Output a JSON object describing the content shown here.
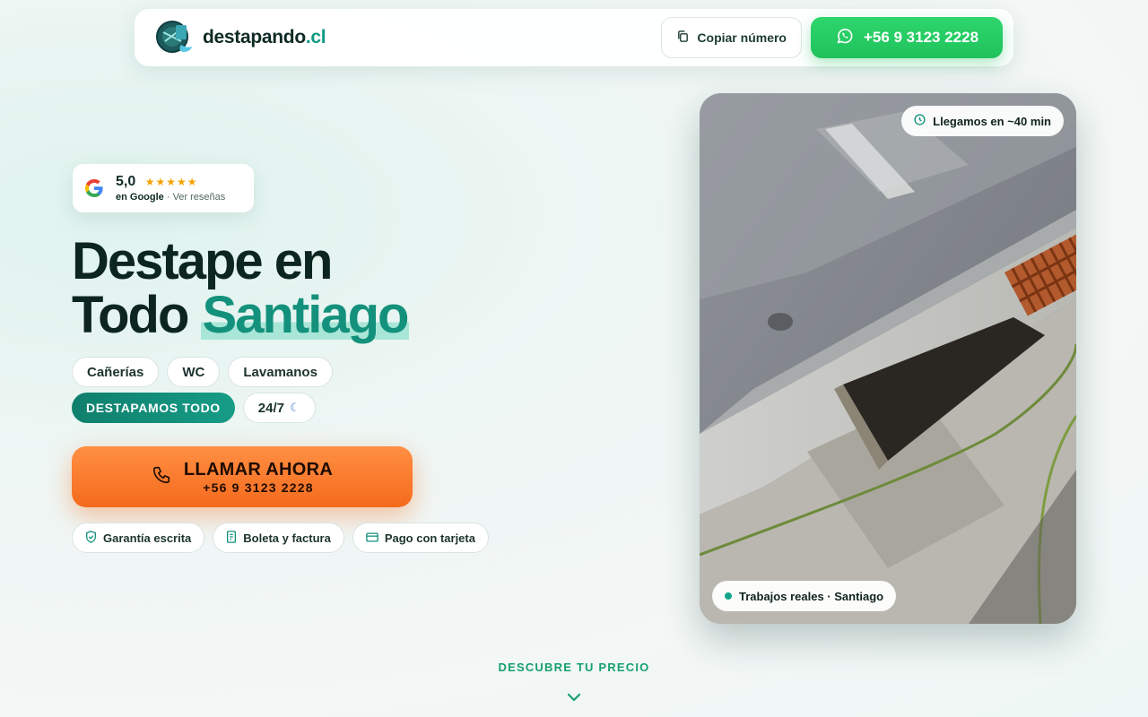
{
  "header": {
    "brand_name": "destapando",
    "brand_tld": ".cl",
    "copy_label": "Copiar número",
    "whatsapp_label": "+56 9 3123 2228"
  },
  "rating": {
    "score": "5,0",
    "stars": "★★★★★",
    "source": "en Google",
    "separator": " · ",
    "reviews_link": "Ver reseñas"
  },
  "hero": {
    "title_line1": "Destape en",
    "title_line2_plain": "Todo ",
    "title_line2_accent": "Santiago"
  },
  "chips": {
    "row1": [
      "Cañerías",
      "WC",
      "Lavamanos"
    ],
    "primary": "DESTAPAMOS TODO",
    "hours": "24/7"
  },
  "cta": {
    "label": "LLAMAR AHORA",
    "number": "+56 9 3123 2228"
  },
  "badges": [
    "Garantía escrita",
    "Boleta y factura",
    "Pago con tarjeta"
  ],
  "photo": {
    "eta_label": "Llegamos en ~40 min",
    "caption": "Trabajos reales · Santiago"
  },
  "footer": {
    "discover_label": "DESCUBRE TU PRECIO"
  },
  "icons": {
    "copy": "copy-icon",
    "whatsapp": "whatsapp-icon",
    "google": "google-icon",
    "phone": "phone-icon",
    "shield": "shield-icon",
    "receipt": "receipt-icon",
    "card": "credit-card-icon",
    "clock": "clock-icon",
    "moon": "moon-icon",
    "chevron": "chevron-down-icon"
  },
  "colors": {
    "accent_teal": "#13917c",
    "whatsapp_green": "#25d366",
    "cta_orange": "#f56a1c",
    "star_gold": "#f5a300"
  }
}
